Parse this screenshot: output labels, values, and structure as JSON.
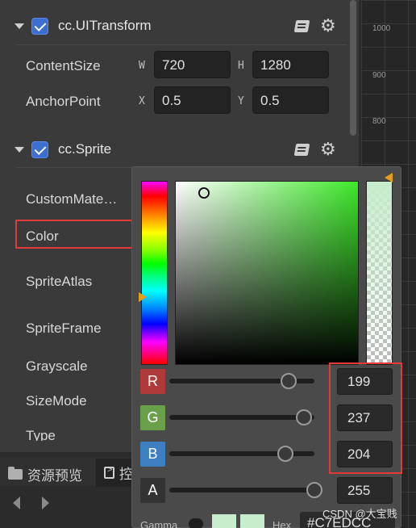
{
  "components": [
    {
      "title": "cc.UITransform"
    },
    {
      "title": "cc.Sprite"
    }
  ],
  "content_size": {
    "label": "ContentSize",
    "w_axis": "W",
    "w_value": "720",
    "h_axis": "H",
    "h_value": "1280"
  },
  "anchor_point": {
    "label": "AnchorPoint",
    "x_axis": "X",
    "x_value": "0.5",
    "y_axis": "Y",
    "y_value": "0.5"
  },
  "sprite_props": [
    "CustomMate…",
    "Color",
    "SpriteAtlas",
    "SpriteFrame",
    "Grayscale",
    "SizeMode",
    "Type"
  ],
  "ruler": [
    "1000",
    "900",
    "800"
  ],
  "bottom_tabs": {
    "assets_preview": "资源预览",
    "console_partial": "控"
  },
  "picker": {
    "hue_gradient": "rainbow",
    "channels": [
      {
        "letter": "R",
        "value": "199",
        "color": "#b03a3a",
        "fraction": 0.82
      },
      {
        "letter": "G",
        "value": "237",
        "color": "#6aa04a",
        "fraction": 0.93
      },
      {
        "letter": "B",
        "value": "204",
        "color": "#3d7fc1",
        "fraction": 0.8
      },
      {
        "letter": "A",
        "value": "255",
        "color": "#333333",
        "fraction": 1.0
      }
    ],
    "gamma_label": "Gamma",
    "hex_label": "Hex",
    "hex_value": "#C7EDCC",
    "current_color": "#c7edcc"
  },
  "watermark": "CSDN @大宝贱"
}
